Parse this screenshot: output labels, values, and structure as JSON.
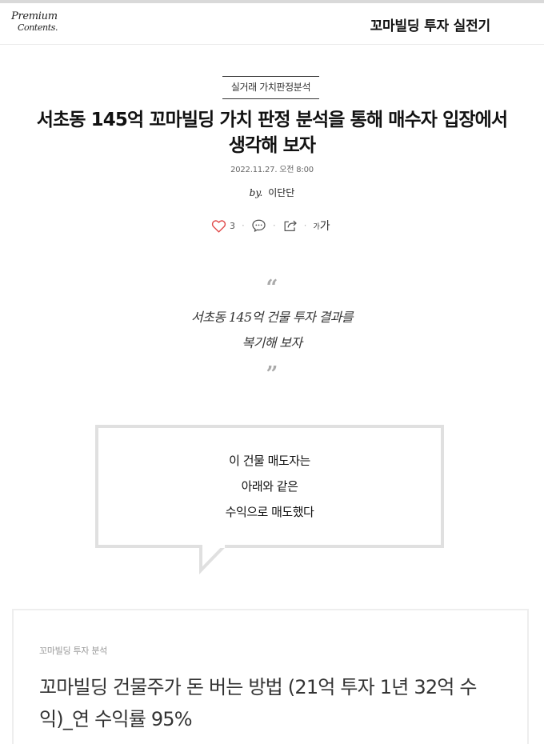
{
  "header": {
    "logo_line1": "Premium",
    "logo_line2": "Contents.",
    "magazine_title": "꼬마빌딩 투자 실전기"
  },
  "article": {
    "category": "실거래 가치판정분석",
    "title": "서초동 145억 꼬마빌딩 가치 판정 분석을 통해 매수자 입장에서 생각해 보자",
    "date": "2022.11.27. 오전 8:00",
    "by_prefix": "by.",
    "author": "이단단"
  },
  "actions": {
    "like_count": "3",
    "font_label_small": "가",
    "font_label_large": "가"
  },
  "quote": {
    "open_mark": "“",
    "line1": "서초동 145억 건물 투자 결과를",
    "line2": "복기해 보자",
    "close_mark": "”"
  },
  "speech_box": {
    "line1": "이 건물 매도자는",
    "line2": "아래와 같은",
    "line3": "수익으로 매도했다"
  },
  "related_card": {
    "category": "꼬마빌딩 투자 분석",
    "title": "꼬마빌딩 건물주가 돈 버는 방법 (21억 투자 1년 32억 수익)_연 수익률 95%"
  },
  "colors": {
    "heart_outline": "#e04a4a",
    "box_border": "#e0e0e0",
    "quote_mark": "#aaaaaa"
  },
  "icons": {
    "like": "heart-outline-icon",
    "comment": "speech-bubble-icon",
    "share": "share-arrow-icon"
  }
}
